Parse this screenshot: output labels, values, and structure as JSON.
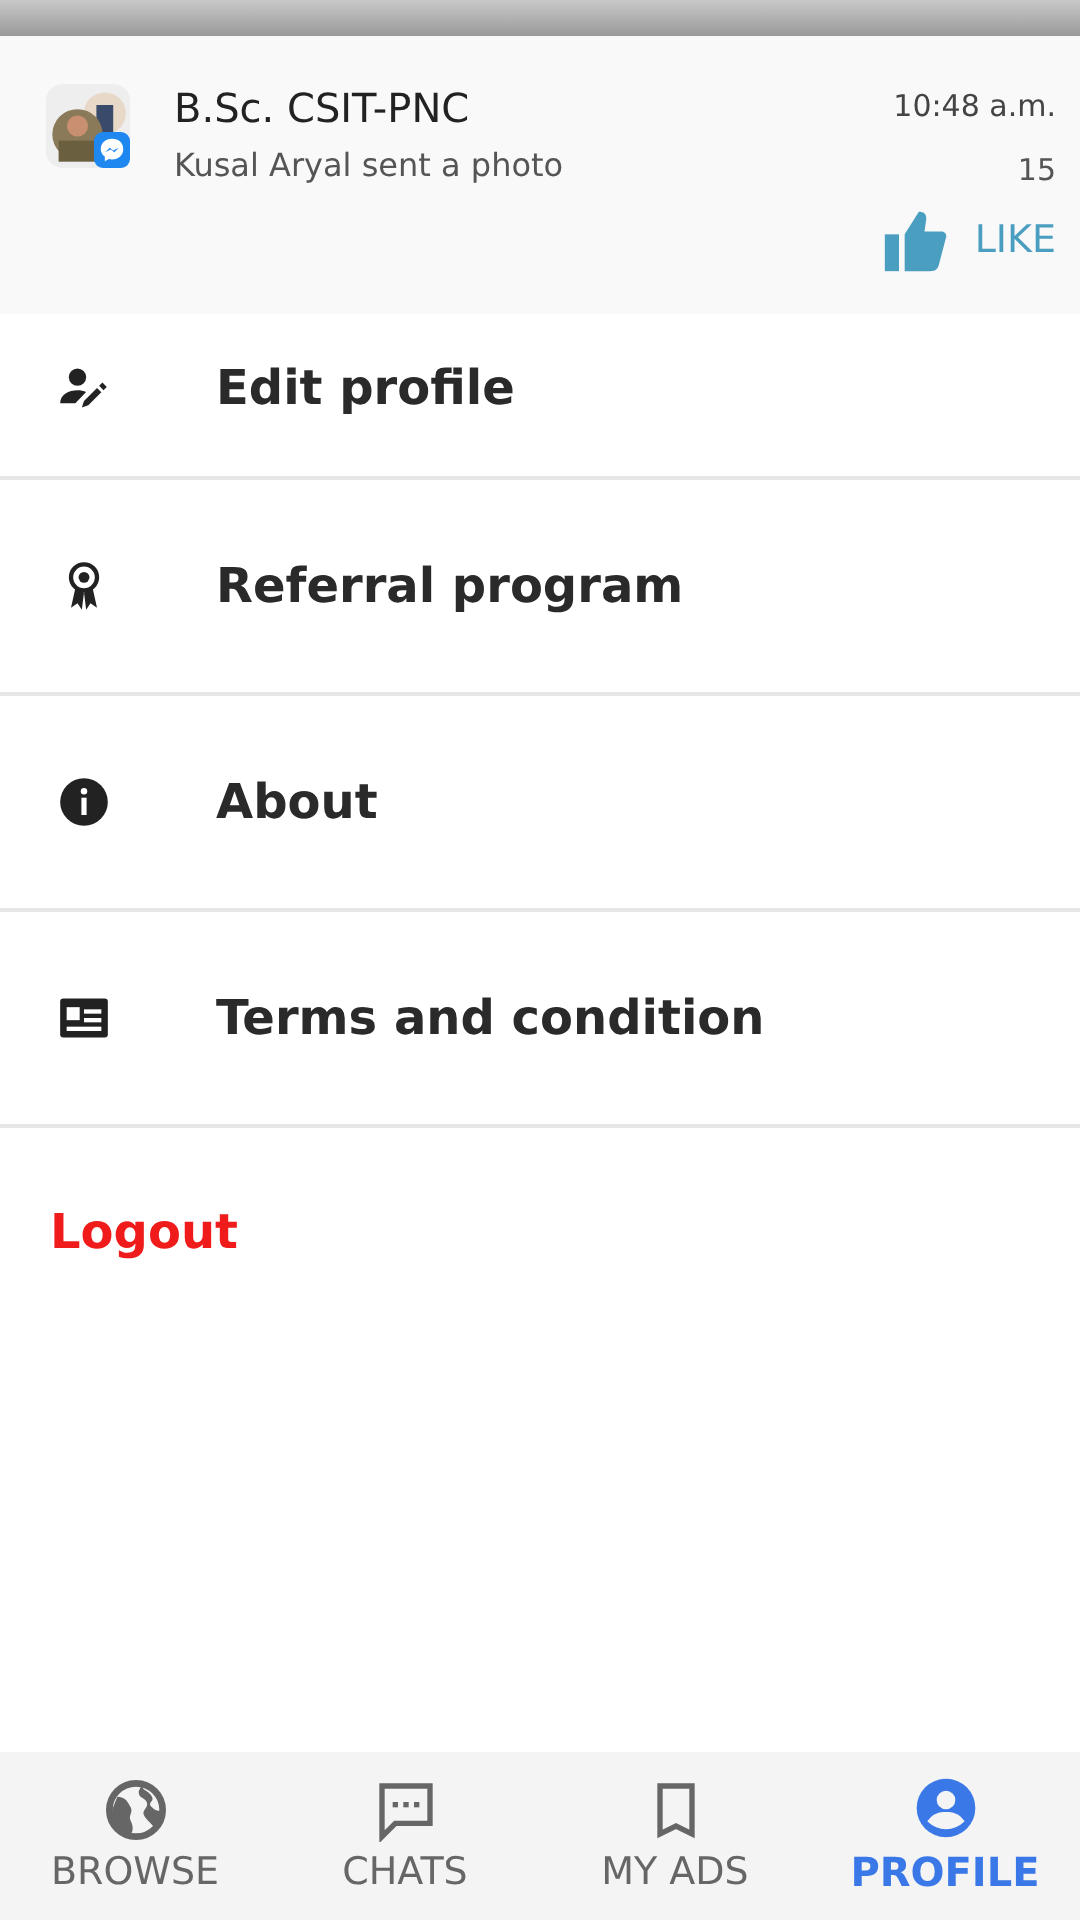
{
  "notification": {
    "title": "B.Sc. CSIT-PNC",
    "message": "Kusal Aryal sent a photo",
    "time": "10:48 a.m.",
    "count": "15",
    "action": "LIKE"
  },
  "menu": [
    {
      "kind": "edit",
      "label": "Edit profile"
    },
    {
      "kind": "referral",
      "label": "Referral program"
    },
    {
      "kind": "about",
      "label": "About"
    },
    {
      "kind": "terms",
      "label": "Terms and condition"
    }
  ],
  "logout": "Logout",
  "nav": [
    {
      "kind": "browse",
      "label": "BROWSE",
      "selected": false
    },
    {
      "kind": "chats",
      "label": "CHATS",
      "selected": false
    },
    {
      "kind": "ads",
      "label": "MY ADS",
      "selected": false
    },
    {
      "kind": "profile",
      "label": "PROFILE",
      "selected": true
    }
  ]
}
